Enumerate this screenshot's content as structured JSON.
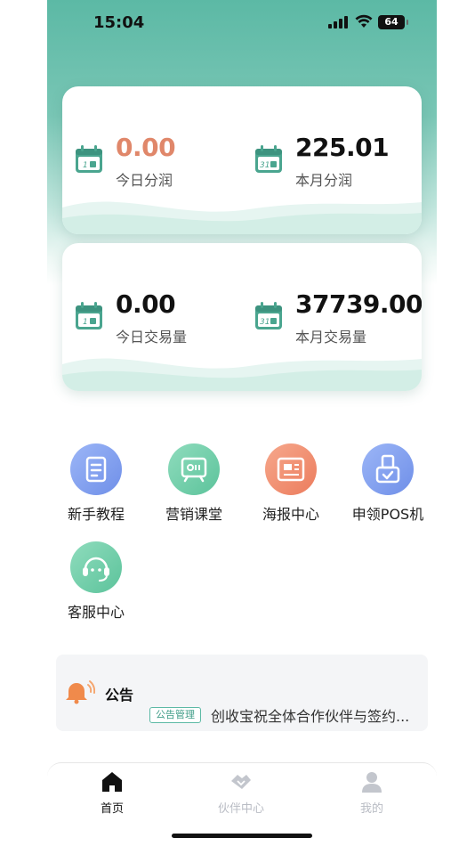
{
  "status_bar": {
    "time": "15:04",
    "battery": "64"
  },
  "profit_card": {
    "today": {
      "value": "0.00",
      "label": "今日分润",
      "calendar_day": "1"
    },
    "month": {
      "value": "225.01",
      "label": "本月分润",
      "calendar_day": "31"
    }
  },
  "volume_card": {
    "today": {
      "value": "0.00",
      "label": "今日交易量",
      "calendar_day": "1"
    },
    "month": {
      "value": "37739.00",
      "label": "本月交易量",
      "calendar_day": "31"
    }
  },
  "menu": {
    "items": [
      {
        "label": "新手教程",
        "icon": "document-icon",
        "color": "#7f9ef0"
      },
      {
        "label": "营销课堂",
        "icon": "classroom-icon",
        "color": "#6fcfa8"
      },
      {
        "label": "海报中心",
        "icon": "poster-icon",
        "color": "#f08a68"
      },
      {
        "label": "申领POS机",
        "icon": "pos-machine-icon",
        "color": "#7f9ef0"
      },
      {
        "label": "客服中心",
        "icon": "headset-icon",
        "color": "#6fcfa8"
      }
    ]
  },
  "notice": {
    "title": "公告",
    "tag": "公告管理",
    "text": "创收宝祝全体合作伙伴与签约..."
  },
  "tabbar": {
    "tabs": [
      {
        "label": "首页",
        "icon": "home-icon",
        "active": true
      },
      {
        "label": "伙伴中心",
        "icon": "handshake-icon",
        "active": false
      },
      {
        "label": "我的",
        "icon": "user-icon",
        "active": false
      }
    ]
  },
  "colors": {
    "accent": "#5cb9a5",
    "orange": "#e0876a",
    "calendar": "#4aa58f"
  }
}
